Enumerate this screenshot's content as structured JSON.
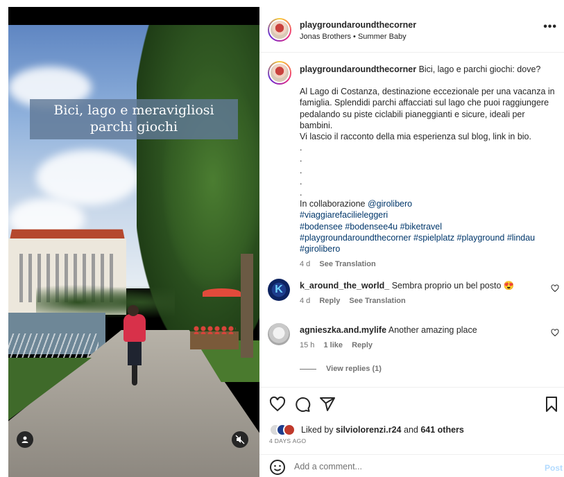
{
  "post": {
    "username": "playgroundaroundthecorner",
    "audio": "Jonas Brothers • Summer Baby",
    "more_label": "•••",
    "overlay_text": "Bici, lago e meravigliosi parchi giochi"
  },
  "caption": {
    "username": "playgroundaroundthecorner",
    "lines": [
      "Bici, lago e parchi giochi: dove?",
      "",
      "Al Lago di Costanza, destinazione eccezionale per una vacanza in famiglia. Splendidi parchi affacciati sul lago che puoi raggiungere pedalando su piste ciclabili pianeggianti e sicure, ideali per bambini.",
      "Vi lascio il racconto della mia esperienza sul blog, link in bio.",
      ".",
      ".",
      ".",
      ".",
      "."
    ],
    "collab_prefix": "In collaborazione ",
    "collab_mention": "@girolibero",
    "hashtags_lines": [
      "#viaggiarefacilieleggeri",
      "#bodensee #bodensee4u #biketravel",
      "#playgroundaroundthecorner #spielplatz #playground #lindau",
      "#girolibero"
    ],
    "time": "4 d",
    "see_translation": "See Translation"
  },
  "comments": [
    {
      "username": "k_around_the_world_",
      "text": "Sembra proprio un bel posto 😍",
      "avatar_letter": "K",
      "time": "4 d",
      "reply": "Reply",
      "see_translation": "See Translation"
    },
    {
      "username": "agnieszka.and.mylife",
      "text": "Another amazing place",
      "time": "15 h",
      "likes": "1 like",
      "reply": "Reply"
    }
  ],
  "view_replies": "View replies (1)",
  "likes": {
    "prefix": "Liked by ",
    "user": "silviolorenzi.r24",
    "middle": " and ",
    "others": "641 others"
  },
  "date": "4 DAYS AGO",
  "add_comment": {
    "placeholder": "Add a comment...",
    "post_label": "Post"
  },
  "colors": {
    "link": "#00376b",
    "post_disabled": "#b3dbff",
    "secondary_text": "#737373"
  }
}
